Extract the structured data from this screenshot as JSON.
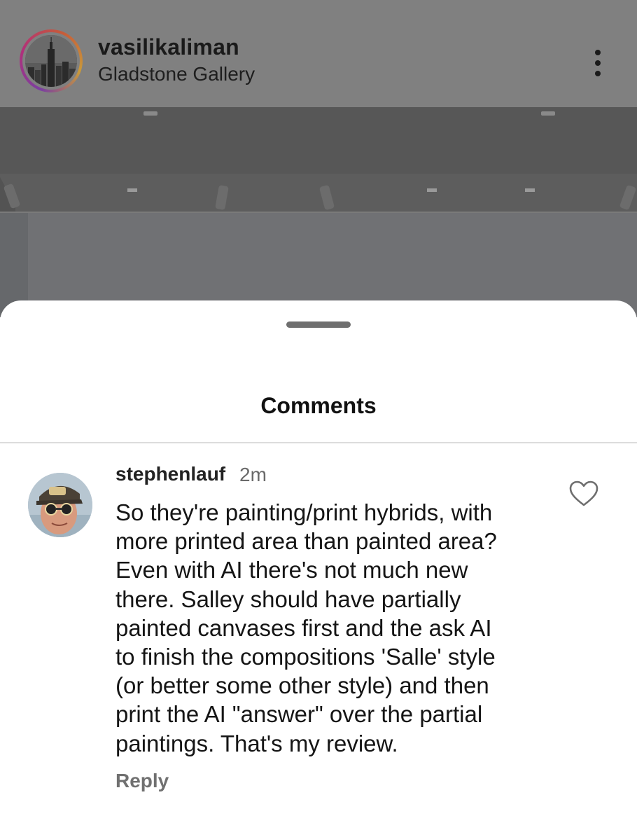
{
  "post": {
    "username": "vasilikaliman",
    "location": "Gladstone Gallery",
    "more_icon": "more-vertical-icon"
  },
  "comments_sheet": {
    "title": "Comments",
    "comments": [
      {
        "username": "stephenlauf",
        "time": "2m",
        "text_lines": [
          "So they're painting/print hybrids, with",
          "more printed area than painted area?",
          "Even with AI there's not much new",
          "there. Salley should have partially",
          "painted canvases first and the ask AI",
          "to finish the compositions 'Salle' style",
          "(or better some other style) and then",
          "print the AI \"answer\" over the partial",
          "paintings. That's my review."
        ],
        "reply_label": "Reply",
        "like_icon": "heart-outline-icon"
      }
    ]
  },
  "colors": {
    "dim_overlay": "#808080",
    "sheet_bg": "#ffffff",
    "secondary_text": "#6a6a6a"
  }
}
